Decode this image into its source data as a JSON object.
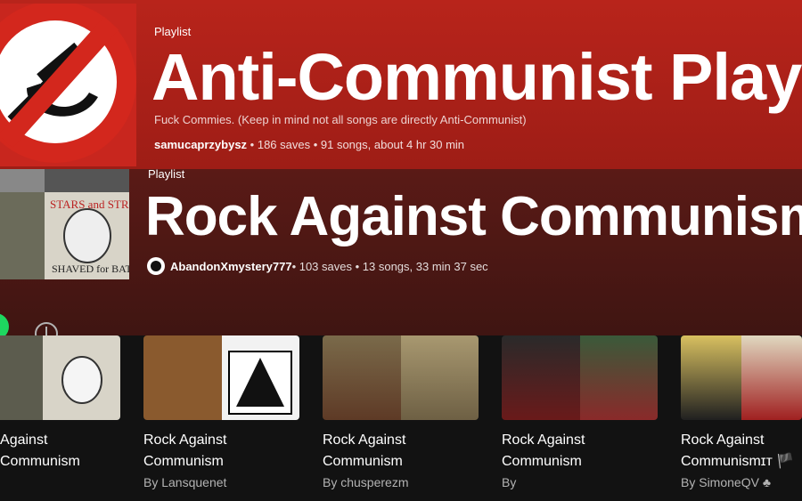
{
  "banner1": {
    "label": "Playlist",
    "title": "Anti-Communist Playlist",
    "description": "Fuck Commies. (Keep in mind not all songs are directly Anti-Communist)",
    "owner": "samucaprzybysz",
    "stats": " • 186 saves • 91 songs, about 4 hr 30 min",
    "cover_icon": "crossed-hammer-sickle-icon"
  },
  "banner2": {
    "label": "Playlist",
    "title": "Rock Against Communism",
    "owner": "AbandonXmystery777",
    "stats": " • 103 saves • 13 songs, 33 min 37 sec"
  },
  "cards": [
    {
      "title": "Rock Against Communism",
      "by": ""
    },
    {
      "title": "Rock Against Communism",
      "by": "By Lansquenet"
    },
    {
      "title": "Rock Against Communism",
      "by": "By chusperezm"
    },
    {
      "title": "Rock Against Communism",
      "by": "By"
    },
    {
      "title": "Rock Against Communismɪт 🏴",
      "by": "By SimoneQV ♣"
    }
  ],
  "colors": {
    "banner1": "#b8241b",
    "banner2": "#4a1713",
    "accent": "#1ed760"
  }
}
